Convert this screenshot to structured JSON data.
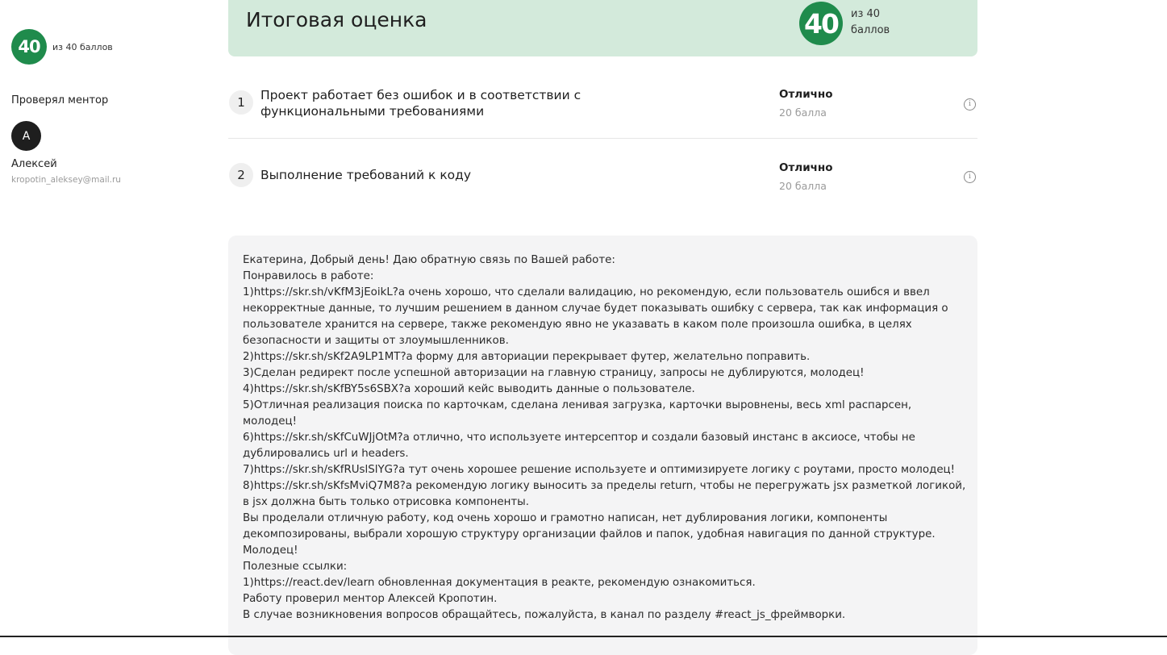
{
  "sidebar": {
    "score": "40",
    "score_of": "из 40 баллов",
    "mentor_label": "Проверял ментор",
    "avatar_initial": "А",
    "mentor_name": "Алексей",
    "mentor_email": "kropotin_aleksey@mail.ru"
  },
  "total": {
    "title": "Итоговая оценка",
    "score": "40",
    "score_of": "из 40 баллов"
  },
  "criteria": [
    {
      "number": "1",
      "title": "Проект работает без ошибок и в соответствии с функциональными требованиями",
      "grade": "Отлично",
      "points": "20 балла"
    },
    {
      "number": "2",
      "title": "Выполнение требований к коду",
      "grade": "Отлично",
      "points": "20 балла"
    }
  ],
  "info_glyph": "i",
  "feedback": {
    "lines": [
      "Екатерина, Добрый день! Даю обратную связь по Вашей работе:",
      "Понравилось в работе:",
      "1)https://skr.sh/vKfM3jEoikL?a очень хорошо, что сделали валидацию, но рекомендую, если пользователь ошибся и ввел",
      "некорректные данные, то лучшим решением в данном случае будет показывать ошибку с сервера, так как информация о",
      "пользователе хранится на сервере, также рекомендую явно не указавать в каком поле произошла ошибка, в целях",
      "безопасности и защиты от злоумышленников.",
      "2)https://skr.sh/sKf2A9LP1MT?a форму для авториации перекрывает футер, желательно поправить.",
      "3)Сделан редирект после успешной авторизации на главную страницу, запросы не дублируются, молодец!",
      "4)https://skr.sh/sKfBY5s6SBX?a хороший кейс выводить данные о пользователе.",
      "5)Отличная реализация поиска по карточкам, сделана ленивая загрузка, карточки выровнены, весь xml распарсен,",
      "молодец!",
      "6)https://skr.sh/sKfCuWJjOtM?a отлично, что используете интерсептор и создали базовый инстанс в аксиосе, чтобы не",
      "дублировались url и headers.",
      "7)https://skr.sh/sKfRUslSlYG?a тут очень хорошее решение используете и оптимизируете логику с роутами, просто молодец!",
      "8)https://skr.sh/sKfsMviQ7M8?a рекомендую логику выносить за пределы return, чтобы не перегружать jsx разметкой логикой,",
      "в jsx должна быть только отрисовка компоненты.",
      "Вы проделали отличную работу, код очень хорошо и грамотно написан, нет дублирования логики, компоненты",
      "декомпозированы, выбрали хорошую структуру организации файлов и папок, удобная навигация по данной структуре.",
      "Молодец!",
      "Полезные ссылки:",
      "1)https://react.dev/learn обновленная документация в реакте, рекомендую ознакомиться.",
      "Работу проверил ментор Алексей Кропотин.",
      "В случае возникновения вопросов обращайтесь, пожалуйста, в канал по разделу #react_js_фреймворки."
    ]
  }
}
